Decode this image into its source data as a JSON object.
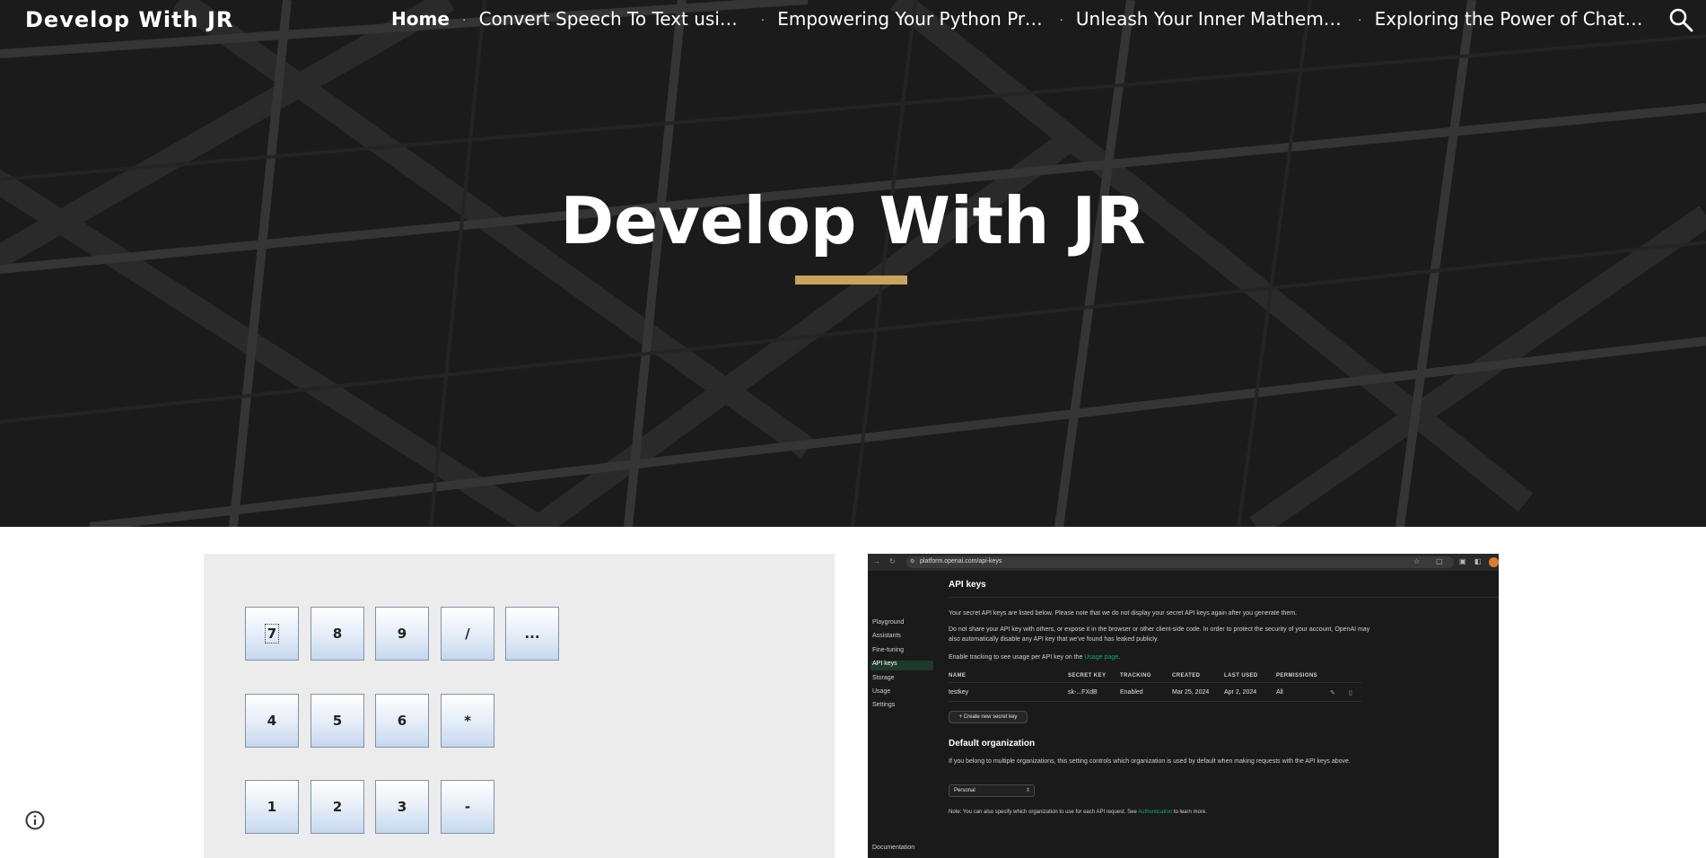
{
  "site": {
    "title": "Develop With JR",
    "hero_title": "Develop With JR",
    "accent_color": "#c9a45c"
  },
  "nav": {
    "items": [
      {
        "label": "Home",
        "active": true
      },
      {
        "label": "Convert Speech To Text using ..."
      },
      {
        "label": "Empowering Your Python Proj..."
      },
      {
        "label": "Unleash Your Inner Mathemat..."
      },
      {
        "label": "Exploring the Power of ChatG..."
      }
    ],
    "separator": "·",
    "search_icon": "search-icon"
  },
  "calculator": {
    "rows": [
      [
        "7",
        "8",
        "9",
        "/",
        "..."
      ],
      [
        "4",
        "5",
        "6",
        "*"
      ],
      [
        "1",
        "2",
        "3",
        "-"
      ]
    ],
    "focused_key": "7"
  },
  "api_screenshot": {
    "url": "platform.openai.com/api-keys",
    "sidebar": [
      "Playground",
      "Assistants",
      "Fine-tuning",
      "API keys",
      "Storage",
      "Usage",
      "Settings"
    ],
    "sidebar_active": "API keys",
    "sidebar_footer": "Documentation",
    "title": "API keys",
    "intro": "Your secret API keys are listed below. Please note that we do not display your secret API keys again after you generate them.",
    "warning": "Do not share your API key with others, or expose it in the browser or other client-side code. In order to protect the security of your account, OpenAI may also automatically disable any API key that we've found has leaked publicly.",
    "tracking_prefix": "Enable tracking to see usage per API key on the ",
    "tracking_link": "Usage page",
    "tracking_suffix": ".",
    "columns": [
      "NAME",
      "SECRET KEY",
      "TRACKING",
      "CREATED",
      "LAST USED",
      "PERMISSIONS"
    ],
    "row": {
      "name": "testkey",
      "secret": "sk-...FXdB",
      "tracking": "Enabled",
      "created": "Mar 25, 2024",
      "last_used": "Apr 2, 2024",
      "permissions": "All"
    },
    "create_button": "+ Create new secret key",
    "org_title": "Default organization",
    "org_text": "If you belong to multiple organizations, this setting controls which organization is used by default when making requests with the API keys above.",
    "org_value": "Personal",
    "note_prefix": "Note: You can also specify which organization to use for each API request. See ",
    "note_link": "Authentication",
    "note_suffix": " to learn more."
  },
  "info_icon": "info-icon"
}
